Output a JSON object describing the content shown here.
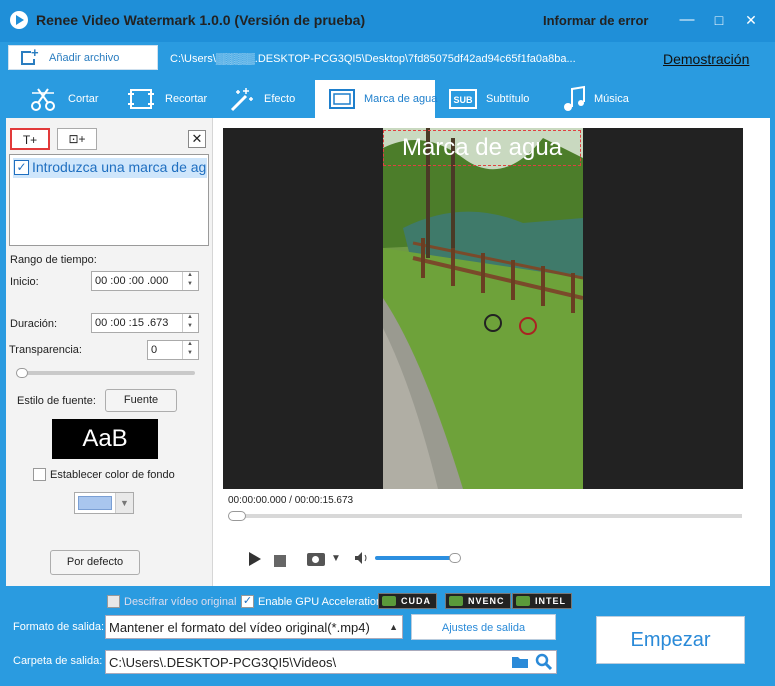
{
  "app": {
    "title": "Renee Video Watermark 1.0.0 (Versión de prueba)",
    "report_error": "Informar de error",
    "minimize": "—",
    "maximize": "□",
    "close": "✕"
  },
  "toolbar": {
    "add_file": "Añadir archivo",
    "file_path": "C:\\Users\\▒▒▒▒▒.DESKTOP-PCG3QI5\\Desktop\\7fd85075df42ad94c65f1fa0a8ba...",
    "demo": "Demostración"
  },
  "tabs": [
    {
      "label": "Cortar",
      "icon": "scissors-icon"
    },
    {
      "label": "Recortar",
      "icon": "film-crop-icon"
    },
    {
      "label": "Efecto",
      "icon": "magic-wand-icon"
    },
    {
      "label": "Marca de agua",
      "icon": "watermark-icon",
      "active": true
    },
    {
      "label": "Subtítulo",
      "icon": "subtitle-icon"
    },
    {
      "label": "Música",
      "icon": "music-icon"
    }
  ],
  "left": {
    "add_text_btn": "T+",
    "add_image_btn": "⊡+",
    "delete_btn": "✕",
    "watermark_item": "Introduzca una marca de agua",
    "time_range_label": "Rango de tiempo:",
    "start_label": "Inicio:",
    "start_value": "00 :00 :00 .000",
    "duration_label": "Duración:",
    "duration_value": "00 :00 :15 .673",
    "transparency_label": "Transparencia:",
    "transparency_value": "0",
    "transparency_level": 0,
    "font_style_label": "Estilo de fuente:",
    "font_btn": "Fuente",
    "font_preview": "AaB",
    "bg_color_label": "Establecer color de fondo",
    "bg_color": "#a9c6ee",
    "default_btn": "Por defecto"
  },
  "player": {
    "watermark_text": "Marca de agua",
    "time": "00:00:00.000 / 00:00:15.673",
    "progress": 0,
    "volume": 0.95
  },
  "bottom": {
    "decrypt_label": "Descifrar vídeo original",
    "decrypt_checked": false,
    "gpu_label": "Enable GPU Acceleration",
    "gpu_checked": true,
    "badges": [
      "CUDA",
      "NVENC",
      "INTEL"
    ],
    "output_format_label": "Formato de salida:",
    "output_format_value": "Mantener el formato del vídeo original(*.mp4)",
    "output_settings_btn": "Ajustes de salida",
    "output_folder_label": "Carpeta de salida:",
    "output_folder_value": "C:\\Users\\.DESKTOP-PCG3QI5\\Videos\\",
    "start_btn": "Empezar"
  }
}
